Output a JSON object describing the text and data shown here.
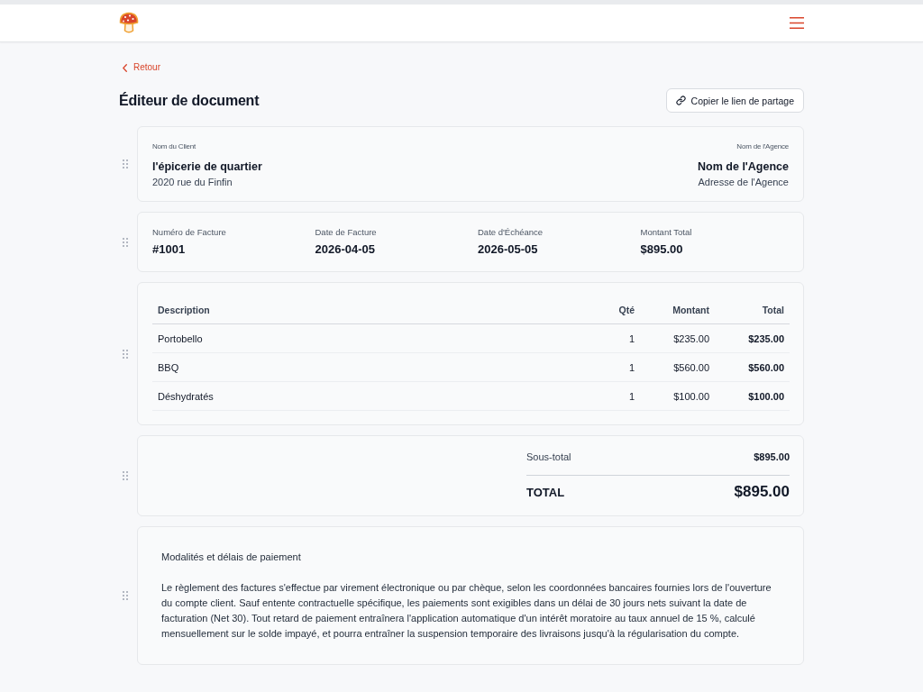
{
  "back_link": {
    "label": "Retour"
  },
  "page_title": "Éditeur de document",
  "share_button": {
    "label": "Copier le lien de partage"
  },
  "blocks": [
    {
      "kind": "parties",
      "client": {
        "label": "Nom du Client",
        "name": "l'épicerie de quartier",
        "address": "2020 rue du Finfin"
      },
      "agency": {
        "label": "Nom de l'Agence",
        "name": "Nom de l'Agence",
        "address": "Adresse de l'Agence"
      }
    },
    {
      "kind": "details",
      "fields": [
        {
          "label": "Numéro de Facture",
          "value": "#1001"
        },
        {
          "label": "Date de Facture",
          "value": "2026-04-05"
        },
        {
          "label": "Date d'Échéance",
          "value": "2026-05-05"
        },
        {
          "label": "Montant Total",
          "value": "$895.00"
        }
      ]
    },
    {
      "kind": "items",
      "columns": [
        "Description",
        "Qté",
        "Montant",
        "Total"
      ],
      "rows": [
        [
          "Portobello",
          "1",
          "$235.00",
          "$235.00"
        ],
        [
          "BBQ",
          "1",
          "$560.00",
          "$560.00"
        ],
        [
          "Déshydratés",
          "1",
          "$100.00",
          "$100.00"
        ]
      ]
    },
    {
      "kind": "totals",
      "subtotal": {
        "label": "Sous-total",
        "value": "$895.00"
      },
      "total": {
        "label": "TOTAL",
        "value": "$895.00"
      }
    },
    {
      "kind": "terms",
      "title": "Modalités et délais de paiement",
      "body": "Le règlement des factures s'effectue par virement électronique ou par chèque, selon les coordonnées bancaires fournies lors de l'ouverture du compte client. Sauf entente contractuelle spécifique, les paiements sont exigibles dans un délai de 30 jours nets suivant la date de facturation (Net 30). Tout retard de paiement entraînera l'application automatique d'un intérêt moratoire au taux annuel de 15 %, calculé mensuellement sur le solde impayé, et pourra entraîner la suspension temporaire des livraisons jusqu'à la régularisation du compte."
    }
  ]
}
